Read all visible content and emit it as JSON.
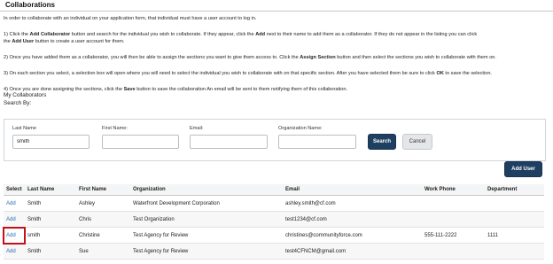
{
  "page": {
    "title": "Collaborations",
    "intro": "In order to collaborate with an individual on your application form, that individual must have a user account to log in.",
    "step1": {
      "a": "1) Click the ",
      "b": "Add Collaborator",
      "c": " button and search for the individual you wish to collaborate.  If they appear, click the ",
      "d": "Add",
      "e": " next to their name to add them as a collaborator.  If they do not appear in the listing you can click",
      "f": "the ",
      "g": "Add User",
      "h": " button to create a user account for them."
    },
    "step2": {
      "a": "2) Once you have added them as a collaborator, you will then be able to assign the sections you want to give them access to.  Click the ",
      "b": "Assign Section",
      "c": " button and then select the sections you wish to collaborate with them on."
    },
    "step3": {
      "a": "3) On each section you select, a selection box will open where you will need to select the individual you wish to collaborate with on that specific section.  After you have selected them be sure to click ",
      "b": "OK",
      "c": " to save the selection."
    },
    "step4": {
      "a": "4) Once you are done assigning the sections, click the ",
      "b": "Save",
      "c": " button to save the collaboration An email will be sent to them notifying them of this collaboration."
    },
    "my_collaborators": "My Collaborators",
    "search_by": "Search By:"
  },
  "search": {
    "last_name_label": "Last Name",
    "last_name_value": "smith",
    "first_name_label": "First Name:",
    "first_name_value": "",
    "email_label": "Email:",
    "email_value": "",
    "org_label": "Organization Name:",
    "org_value": "",
    "search_button": "Search",
    "cancel_button": "Cancel"
  },
  "add_user_button": "Add User",
  "table": {
    "headers": [
      "Select",
      "Last Name",
      "First Name",
      "Organization",
      "Email",
      "Work Phone",
      "Department"
    ],
    "add_label": "Add",
    "rows": [
      {
        "last": "Smith",
        "first": "Ashley",
        "org": "Waterfront Development Corporation",
        "email": "ashley.smith@cf.com",
        "phone": "",
        "dept": ""
      },
      {
        "last": "Smith",
        "first": "Chris",
        "org": "Test Organization",
        "email": "test1234@cf.com",
        "phone": "",
        "dept": ""
      },
      {
        "last": "smith",
        "first": "Christine",
        "org": "Test Agency for Review",
        "email": "christines@communityforce.com",
        "phone": "555-111-2222",
        "dept": "1111"
      },
      {
        "last": "Smith",
        "first": "Sue",
        "org": "Test Agency for Review",
        "email": "test4CFNCM@gmail.com",
        "phone": "",
        "dept": ""
      }
    ]
  },
  "colors": {
    "primary_button": "#1f3f61",
    "link": "#2a6bb3",
    "highlight": "#c4101a"
  }
}
